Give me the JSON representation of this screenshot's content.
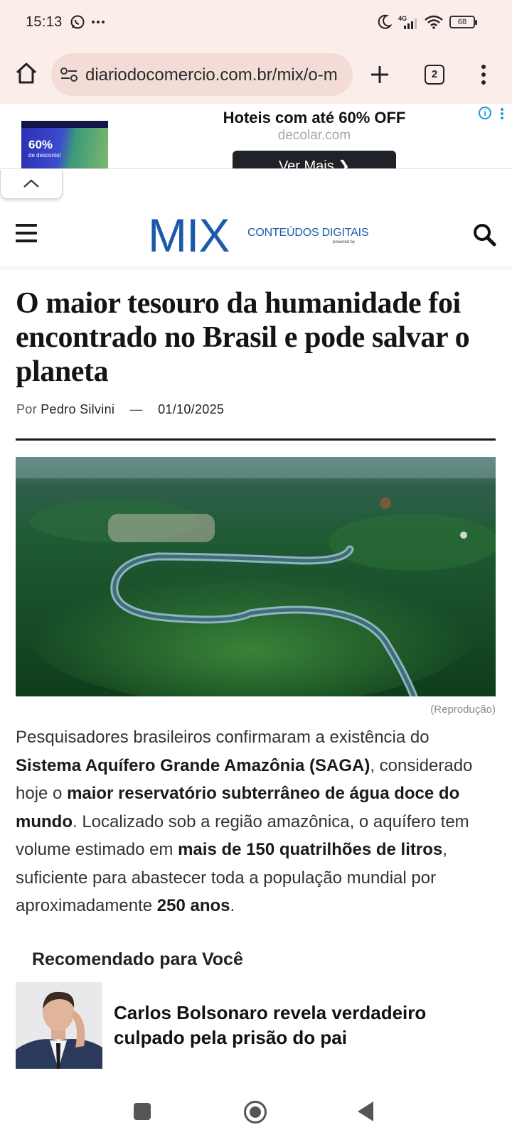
{
  "status_bar": {
    "time": "15:13",
    "network": "4G",
    "battery": "68",
    "icons": [
      "whatsapp-icon",
      "more-notifications-icon",
      "moon-icon",
      "signal-icon",
      "wifi-icon",
      "battery-icon"
    ]
  },
  "browser": {
    "url": "diariodocomercio.com.br/mix/o-m",
    "tab_count": "2",
    "icons": [
      "home-icon",
      "site-settings-icon",
      "new-tab-icon",
      "tab-switcher-icon",
      "menu-icon"
    ]
  },
  "ad": {
    "thumb_discount": "60%",
    "thumb_sub": "de desconto!",
    "title": "Hoteis com até 60% OFF",
    "advertiser": "decolar.com",
    "cta_label": "Ver Mais ❯",
    "info_glyph": "i"
  },
  "site": {
    "logo": "MIX",
    "logo_subtitle": "CONTEÚDOS DIGITAIS",
    "logo_powered": "powered by"
  },
  "article": {
    "title": "O maior tesouro da humanidade foi encontrado no Brasil e pode salvar o planeta",
    "byline_prefix": "Por",
    "author": "Pedro Silvini",
    "byline_separator": "—",
    "date": "01/10/2025",
    "image_caption": "(Reprodução)",
    "paragraph_parts": [
      {
        "text": "Pesquisadores brasileiros confirmaram a existência do ",
        "bold": false
      },
      {
        "text": "Sistema Aquífero Grande Amazônia (SAGA)",
        "bold": true
      },
      {
        "text": ", considerado hoje o ",
        "bold": false
      },
      {
        "text": "maior reservatório subterrâneo de água doce do mundo",
        "bold": true
      },
      {
        "text": ". Localizado sob a região amazônica, o aquífero tem volume estimado em ",
        "bold": false
      },
      {
        "text": "mais de 150 quatrilhões de litros",
        "bold": true
      },
      {
        "text": ", suficiente para abastecer toda a população mundial por aproximadamente ",
        "bold": false
      },
      {
        "text": "250 anos",
        "bold": true
      },
      {
        "text": ".",
        "bold": false
      }
    ]
  },
  "recommended": {
    "heading": "Recomendado para Você",
    "items": [
      {
        "title": "Carlos Bolsonaro revela verdadeiro culpado pela prisão do pai"
      }
    ]
  },
  "nav": {
    "icons": [
      "recents-icon",
      "home-icon",
      "back-icon"
    ]
  }
}
